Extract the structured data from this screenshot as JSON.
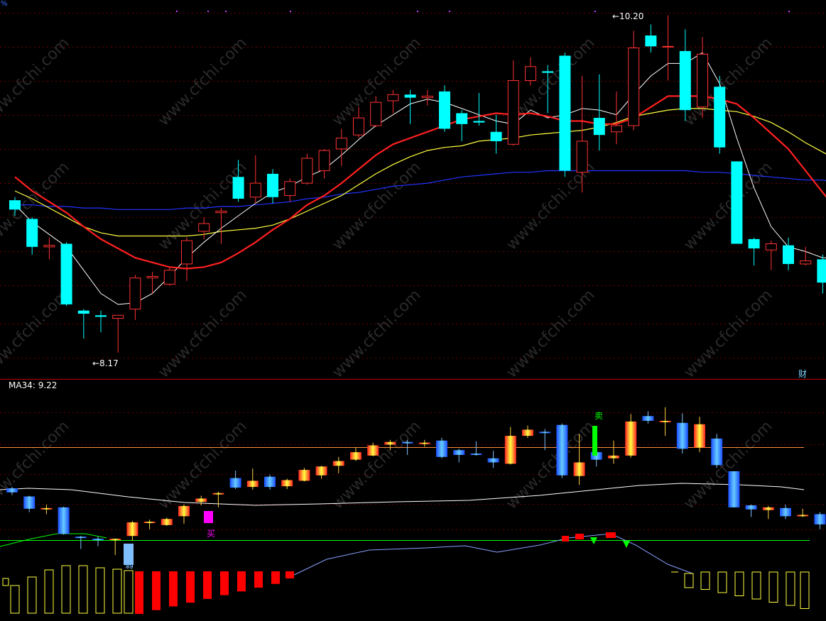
{
  "chart_data": {
    "type": "candlestick",
    "price_range": [
      8.0,
      10.45
    ],
    "labels": {
      "high_label": "10.20",
      "low_label": "8.17",
      "indicator_label": "MA34: 9.22",
      "finance_tag": "财",
      "corner_tag": "%"
    },
    "signals": {
      "buy": "买",
      "sell": "卖",
      "weak": "弱"
    },
    "watermark": "www.cfchi.com",
    "colors": {
      "background": "#000000",
      "up": "#ff3232",
      "down": "#00ffff",
      "ma_short": "#ffffff",
      "ma_mid": "#ff2020",
      "ma_long": "#ffff40",
      "ma_very_long": "#2233ff",
      "grid": "#6a0000",
      "divider": "#c00000",
      "buy": "#ff00ff",
      "sell": "#00ff00",
      "weak": "#7fbfff",
      "upper_band": "#ff8c3a",
      "lower_band": "#00ff00",
      "bar_red": "#ff0000",
      "bar_yellow": "#ffff40",
      "blue_curve": "#8aa0ff"
    },
    "candles": [
      {
        "o": 9.15,
        "c": 9.09,
        "h": 9.17,
        "l": 9.05
      },
      {
        "o": 9.03,
        "c": 8.85,
        "h": 9.04,
        "l": 8.8
      },
      {
        "o": 8.85,
        "c": 8.86,
        "h": 8.91,
        "l": 8.77
      },
      {
        "o": 8.87,
        "c": 8.48,
        "h": 8.88,
        "l": 8.47
      },
      {
        "o": 8.44,
        "c": 8.42,
        "h": 8.45,
        "l": 8.26
      },
      {
        "o": 8.41,
        "c": 8.4,
        "h": 8.44,
        "l": 8.3
      },
      {
        "o": 8.39,
        "c": 8.41,
        "h": 8.41,
        "l": 8.17
      },
      {
        "o": 8.45,
        "c": 8.65,
        "h": 8.67,
        "l": 8.38
      },
      {
        "o": 8.65,
        "c": 8.66,
        "h": 8.69,
        "l": 8.55
      },
      {
        "o": 8.61,
        "c": 8.7,
        "h": 8.72,
        "l": 8.6
      },
      {
        "o": 8.74,
        "c": 8.89,
        "h": 8.91,
        "l": 8.63
      },
      {
        "o": 8.95,
        "c": 9.0,
        "h": 9.04,
        "l": 8.9
      },
      {
        "o": 9.07,
        "c": 9.08,
        "h": 9.1,
        "l": 8.87
      },
      {
        "o": 9.3,
        "c": 9.16,
        "h": 9.41,
        "l": 9.14
      },
      {
        "o": 9.17,
        "c": 9.26,
        "h": 9.44,
        "l": 9.13
      },
      {
        "o": 9.32,
        "c": 9.17,
        "h": 9.35,
        "l": 9.13
      },
      {
        "o": 9.18,
        "c": 9.27,
        "h": 9.29,
        "l": 9.14
      },
      {
        "o": 9.26,
        "c": 9.42,
        "h": 9.45,
        "l": 9.25
      },
      {
        "o": 9.34,
        "c": 9.47,
        "h": 9.48,
        "l": 9.29
      },
      {
        "o": 9.48,
        "c": 9.55,
        "h": 9.61,
        "l": 9.37
      },
      {
        "o": 9.57,
        "c": 9.68,
        "h": 9.75,
        "l": 9.55
      },
      {
        "o": 9.63,
        "c": 9.78,
        "h": 9.82,
        "l": 9.62
      },
      {
        "o": 9.79,
        "c": 9.83,
        "h": 9.86,
        "l": 9.71
      },
      {
        "o": 9.83,
        "c": 9.81,
        "h": 9.86,
        "l": 9.64
      },
      {
        "o": 9.81,
        "c": 9.82,
        "h": 9.86,
        "l": 9.76
      },
      {
        "o": 9.85,
        "c": 9.61,
        "h": 9.89,
        "l": 9.59
      },
      {
        "o": 9.71,
        "c": 9.64,
        "h": 9.73,
        "l": 9.53
      },
      {
        "o": 9.66,
        "c": 9.65,
        "h": 9.84,
        "l": 9.63
      },
      {
        "o": 9.59,
        "c": 9.53,
        "h": 9.7,
        "l": 9.45
      },
      {
        "o": 9.51,
        "c": 9.92,
        "h": 10.05,
        "l": 9.5
      },
      {
        "o": 9.92,
        "c": 10.01,
        "h": 10.07,
        "l": 9.89
      },
      {
        "o": 9.98,
        "c": 9.97,
        "h": 10.02,
        "l": 9.71
      },
      {
        "o": 10.08,
        "c": 9.34,
        "h": 10.1,
        "l": 9.3
      },
      {
        "o": 9.33,
        "c": 9.53,
        "h": 9.95,
        "l": 9.2
      },
      {
        "o": 9.68,
        "c": 9.57,
        "h": 9.96,
        "l": 9.47
      },
      {
        "o": 9.59,
        "c": 9.63,
        "h": 9.85,
        "l": 9.51
      },
      {
        "o": 9.63,
        "c": 10.13,
        "h": 10.24,
        "l": 9.6
      },
      {
        "o": 10.21,
        "c": 10.14,
        "h": 10.28,
        "l": 10.1
      },
      {
        "o": 10.14,
        "c": 10.14,
        "h": 10.34,
        "l": 9.92
      },
      {
        "o": 10.11,
        "c": 9.73,
        "h": 10.25,
        "l": 9.66
      },
      {
        "o": 9.75,
        "c": 10.09,
        "h": 10.2,
        "l": 9.68
      },
      {
        "o": 9.88,
        "c": 9.49,
        "h": 9.95,
        "l": 9.45
      },
      {
        "o": 9.4,
        "c": 8.87,
        "h": 9.4,
        "l": 8.87
      },
      {
        "o": 8.9,
        "c": 8.84,
        "h": 8.91,
        "l": 8.73
      },
      {
        "o": 8.83,
        "c": 8.87,
        "h": 8.89,
        "l": 8.7
      },
      {
        "o": 8.86,
        "c": 8.74,
        "h": 8.91,
        "l": 8.7
      },
      {
        "o": 8.74,
        "c": 8.76,
        "h": 8.85,
        "l": 8.73
      },
      {
        "o": 8.77,
        "c": 8.62,
        "h": 8.8,
        "l": 8.55
      },
      {
        "o": 8.64,
        "c": 8.83,
        "h": 9.06,
        "l": 8.62
      },
      {
        "o": 8.86,
        "c": 8.86,
        "h": 8.89,
        "l": 8.67
      },
      {
        "o": 8.81,
        "c": 8.64,
        "h": 8.83,
        "l": 8.55
      },
      {
        "o": 8.63,
        "c": 8.81,
        "h": 8.81,
        "l": 8.63
      },
      {
        "o": 8.63,
        "c": 8.63,
        "h": 8.68,
        "l": 8.52
      }
    ],
    "ma_short": [
      9.12,
      9.01,
      8.93,
      8.85,
      8.7,
      8.55,
      8.48,
      8.49,
      8.55,
      8.66,
      8.78,
      8.88,
      8.97,
      9.05,
      9.13,
      9.2,
      9.24,
      9.3,
      9.35,
      9.44,
      9.54,
      9.63,
      9.7,
      9.77,
      9.8,
      9.78,
      9.74,
      9.7,
      9.66,
      9.64,
      9.73,
      9.68,
      9.7,
      9.74,
      9.73,
      9.7,
      9.83,
      9.95,
      10.03,
      10.03,
      10.1,
      9.9,
      9.55,
      9.23,
      8.98,
      8.85,
      8.82,
      8.78,
      8.78,
      8.78,
      8.78,
      8.79,
      8.72
    ],
    "ma_mid": [
      9.3,
      9.21,
      9.14,
      9.07,
      8.98,
      8.9,
      8.84,
      8.78,
      8.75,
      8.72,
      8.71,
      8.72,
      8.75,
      8.81,
      8.88,
      8.96,
      9.03,
      9.12,
      9.18,
      9.26,
      9.35,
      9.44,
      9.51,
      9.55,
      9.59,
      9.63,
      9.67,
      9.69,
      9.71,
      9.7,
      9.71,
      9.69,
      9.66,
      9.66,
      9.64,
      9.64,
      9.68,
      9.75,
      9.82,
      9.82,
      9.82,
      9.8,
      9.77,
      9.68,
      9.58,
      9.48,
      9.34,
      9.2,
      9.06,
      8.95,
      8.83,
      8.74,
      8.73
    ],
    "ma_long": [
      9.21,
      9.16,
      9.1,
      9.04,
      8.98,
      8.94,
      8.92,
      8.92,
      8.92,
      8.92,
      8.92,
      8.93,
      8.95,
      8.96,
      8.97,
      8.99,
      9.03,
      9.08,
      9.13,
      9.18,
      9.25,
      9.32,
      9.38,
      9.43,
      9.47,
      9.49,
      9.5,
      9.53,
      9.54,
      9.55,
      9.57,
      9.58,
      9.59,
      9.6,
      9.62,
      9.65,
      9.69,
      9.71,
      9.73,
      9.74,
      9.74,
      9.73,
      9.72,
      9.69,
      9.65,
      9.59,
      9.52,
      9.46,
      9.4,
      9.34,
      9.27,
      9.19,
      9.14
    ],
    "ma_very_long": [
      9.12,
      9.12,
      9.11,
      9.11,
      9.1,
      9.1,
      9.09,
      9.09,
      9.09,
      9.09,
      9.1,
      9.1,
      9.11,
      9.11,
      9.12,
      9.13,
      9.14,
      9.16,
      9.17,
      9.19,
      9.2,
      9.22,
      9.24,
      9.25,
      9.26,
      9.28,
      9.3,
      9.31,
      9.32,
      9.33,
      9.33,
      9.34,
      9.34,
      9.34,
      9.34,
      9.34,
      9.34,
      9.34,
      9.34,
      9.34,
      9.33,
      9.33,
      9.32,
      9.31,
      9.3,
      9.29,
      9.28,
      9.28,
      9.26,
      9.25,
      9.24,
      9.23,
      9.22
    ]
  }
}
